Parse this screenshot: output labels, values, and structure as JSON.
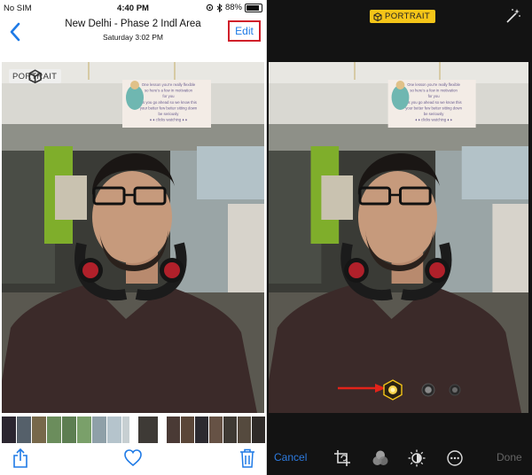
{
  "left": {
    "status_bar": {
      "carrier": "No SIM",
      "time": "4:40 PM",
      "battery": "88%",
      "battery_level": 0.88
    },
    "nav": {
      "title": "New Delhi - Phase 2 Indl Area",
      "subtitle": "Saturday  3:02 PM",
      "edit_label": "Edit"
    },
    "photo": {
      "badge": "PORTRAIT"
    },
    "sign_text": [
      "One lesson you're really flexible",
      "so here's a few in motivation",
      "for you",
      "As you go ahead so we know this",
      "your better few better sitting down",
      "be seriously",
      "♦ ♦ clicks watching ♦ ♦"
    ],
    "toolbar": {
      "share_icon": "share-icon",
      "heart_icon": "heart-icon",
      "trash_icon": "trash-icon"
    }
  },
  "right": {
    "badge": "PORTRAIT",
    "toolbar": {
      "cancel_label": "Cancel",
      "done_label": "Done"
    },
    "colors": {
      "accent": "#2d7be0",
      "badge": "#f5c518",
      "edit_border": "#d0202a"
    }
  }
}
